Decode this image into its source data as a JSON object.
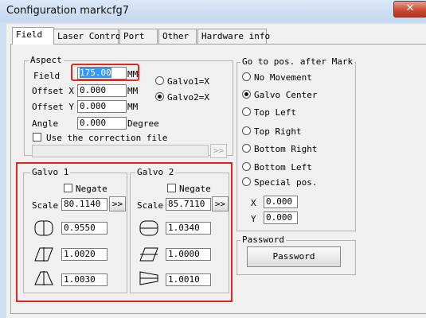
{
  "window": {
    "title": "Configuration markcfg7",
    "close_glyph": "✕"
  },
  "tabs": [
    "Field",
    "Laser Contro",
    "Port",
    "Other",
    "Hardware info"
  ],
  "aspect": {
    "legend": "Aspect",
    "field_label": "Field",
    "field_value": "175.00",
    "field_unit": "MM",
    "offset_x_label": "Offset X",
    "offset_x_value": "0.000",
    "offset_x_unit": "MM",
    "offset_y_label": "Offset Y",
    "offset_y_value": "0.000",
    "offset_y_unit": "MM",
    "angle_label": "Angle",
    "angle_value": "0.000",
    "angle_unit": "Degree",
    "galvo1x_label": "Galvo1=X",
    "galvo2x_label": "Galvo2=X",
    "correction_label": "Use the correction file",
    "correction_path": "",
    "browse_glyph": ">>"
  },
  "galvo1": {
    "legend": "Galvo 1",
    "negate_label": "Negate",
    "scale_label": "Scale",
    "scale_value": "80.1140",
    "arrow_glyph": ">>",
    "bulge_value": "0.9550",
    "para_value": "1.0020",
    "trap_value": "1.0030"
  },
  "galvo2": {
    "legend": "Galvo 2",
    "negate_label": "Negate",
    "scale_label": "Scale",
    "scale_value": "85.7110",
    "arrow_glyph": ">>",
    "bulge_value": "1.0340",
    "para_value": "1.0000",
    "trap_value": "1.0010"
  },
  "goto": {
    "legend": "Go to pos. after Mark",
    "options": [
      "No Movement",
      "Galvo Center",
      "Top Left",
      "Top Right",
      "Bottom Right",
      "Bottom Left",
      "Special pos."
    ],
    "selected": "Galvo Center",
    "x_label": "X",
    "x_value": "0.000",
    "y_label": "Y",
    "y_value": "0.000"
  },
  "password": {
    "legend": "Password",
    "button_label": "Password"
  },
  "colors": {
    "highlight": "#e3261f",
    "selection": "#3399ff"
  }
}
